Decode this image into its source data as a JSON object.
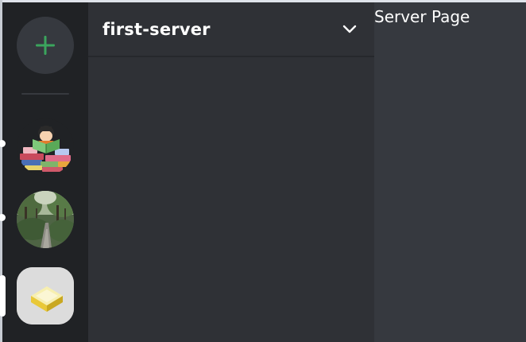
{
  "server_rail": {
    "add_server_icon": "plus-icon",
    "servers": [
      {
        "name": "book-reading-server",
        "icon": "book-illustration",
        "has_unread": true
      },
      {
        "name": "forest-path-server",
        "icon": "forest-photo",
        "has_unread": true
      },
      {
        "name": "soap-server",
        "icon": "soap-illustration",
        "selected": true
      }
    ]
  },
  "channel_panel": {
    "server_name": "first-server",
    "dropdown_icon": "chevron-down-icon"
  },
  "main": {
    "title": "Server Page"
  },
  "colors": {
    "rail_bg": "#202225",
    "panel_bg": "#2f3136",
    "main_bg": "#36393f",
    "accent_green": "#3ba55d",
    "text": "#ffffff"
  }
}
